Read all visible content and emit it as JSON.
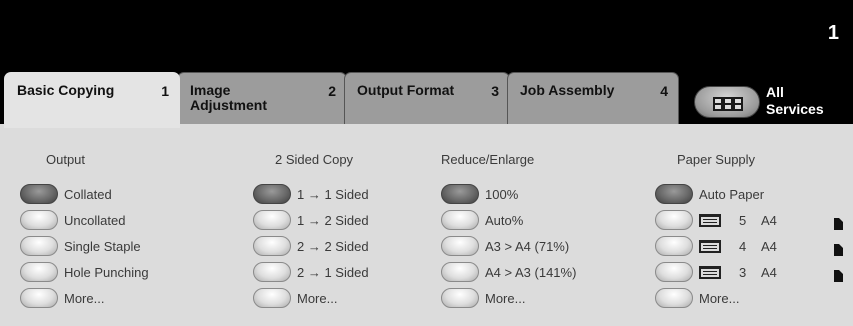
{
  "header": {
    "counter": "1"
  },
  "tabs": [
    {
      "label": "Basic Copying",
      "number": "1",
      "active": true
    },
    {
      "label": "Image Adjustment",
      "number": "2",
      "active": false
    },
    {
      "label": "Output Format",
      "number": "3",
      "active": false
    },
    {
      "label": "Job Assembly",
      "number": "4",
      "active": false
    }
  ],
  "all_services": {
    "label": "All Services",
    "icon": "grid-icon"
  },
  "columns": {
    "output": {
      "title": "Output",
      "options": [
        "Collated",
        "Uncollated",
        "Single Staple",
        "Hole Punching",
        "More..."
      ],
      "selected": 0
    },
    "sided": {
      "title": "2 Sided Copy",
      "options": [
        "1 → 1 Sided",
        "1 → 2 Sided",
        "2 → 2 Sided",
        "2 → 1 Sided",
        "More..."
      ],
      "selected": 0
    },
    "reduce": {
      "title": "Reduce/Enlarge",
      "options": [
        "100%",
        "Auto%",
        "A3 > A4 (71%)",
        "A4 > A3 (141%)",
        "More..."
      ],
      "selected": 0
    },
    "paper": {
      "title": "Paper Supply",
      "auto": "Auto Paper",
      "trays": [
        {
          "number": "5",
          "size": "A4"
        },
        {
          "number": "4",
          "size": "A4"
        },
        {
          "number": "3",
          "size": "A4"
        }
      ],
      "more": "More...",
      "selected": 0
    }
  },
  "colors": {
    "panel": "#dcdcdc",
    "header": "#000000",
    "selected_radio": "#555555"
  }
}
